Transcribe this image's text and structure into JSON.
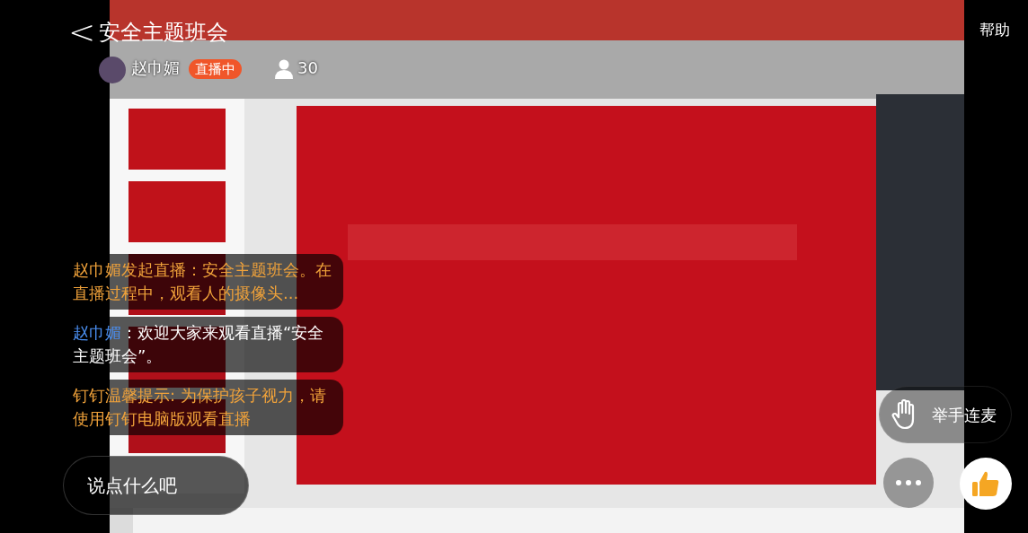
{
  "header": {
    "back": "<",
    "title": "安全主题班会",
    "host": "赵巾媚",
    "badge": "直播中",
    "viewers": "30",
    "help": "帮助"
  },
  "messages": [
    {
      "kind": "system",
      "text": "赵巾媚发起直播：安全主题班会。在直播过程中，观看人的摄像头..."
    },
    {
      "kind": "user",
      "sender": "赵巾媚",
      "text": "：欢迎大家来观看直播“安全主题班会”。"
    },
    {
      "kind": "system",
      "text": "钉钉温馨提示: 为保护孩子视力，请使用钉钉电脑版观看直播"
    }
  ],
  "comment_input": {
    "placeholder": "说点什么吧"
  },
  "raise_hand": "举手连麦"
}
